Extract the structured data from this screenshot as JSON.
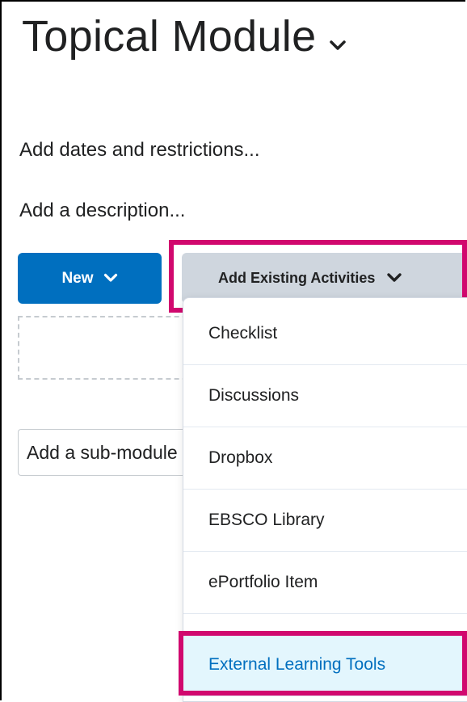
{
  "module": {
    "title": "Topical Module",
    "add_dates_label": "Add dates and restrictions...",
    "add_description_label": "Add a description...",
    "submodule_placeholder": "Add a sub-module"
  },
  "toolbar": {
    "new_label": "New",
    "existing_label": "Add Existing Activities"
  },
  "menu": {
    "items": [
      {
        "label": "Checklist"
      },
      {
        "label": "Discussions"
      },
      {
        "label": "Dropbox"
      },
      {
        "label": "EBSCO Library"
      },
      {
        "label": "ePortfolio Item"
      },
      {
        "label": "External Learning Tools"
      }
    ],
    "highlighted_item": "External Learning Tools"
  },
  "colors": {
    "primary": "#006fbf",
    "highlight_border": "#d1086e",
    "secondary_button": "#cfd6de",
    "active_item_bg": "#e3f6fd"
  },
  "icons": {
    "title_chevron": "chevron-down-icon",
    "button_chevron": "chevron-down-icon"
  }
}
